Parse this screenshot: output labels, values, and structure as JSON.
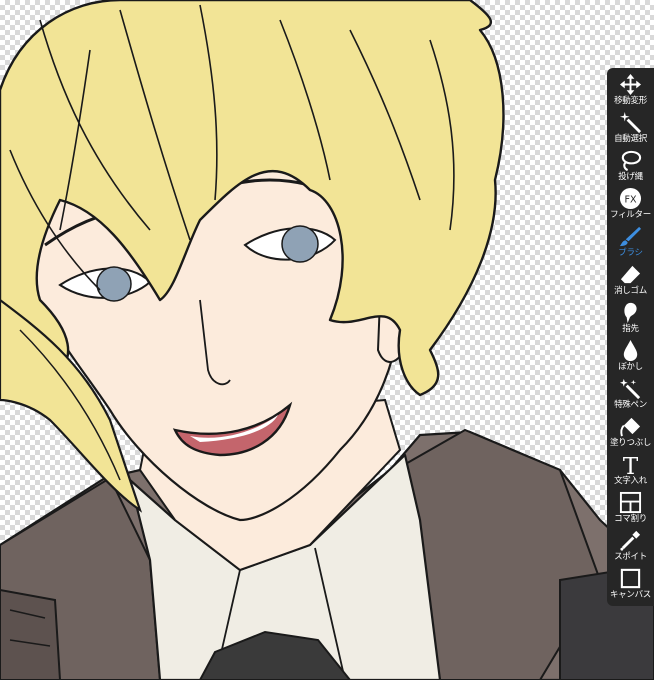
{
  "app": {
    "name": "Drawing canvas with tool palette"
  },
  "colors": {
    "hair": "#f2e496",
    "skin": "#fcebdc",
    "jacket": "#7d706c",
    "shirt": "#f0ede4",
    "tie": "#3a3a3a",
    "eye": "#8fa2b5",
    "mouth": "#c4656c",
    "line": "#1a1a1a",
    "toolbar_bg": "#262626",
    "tool_label": "#ffffff",
    "active_tool": "#3d8ee0"
  },
  "toolbar": {
    "tools": [
      {
        "label": "移動変形",
        "icon": "move-icon",
        "active": false
      },
      {
        "label": "自動選択",
        "icon": "magic-wand-icon",
        "active": false
      },
      {
        "label": "投げ縄",
        "icon": "lasso-icon",
        "active": false
      },
      {
        "label": "フィルター",
        "icon": "fx-icon",
        "fx": "FX",
        "active": false
      },
      {
        "label": "ブラシ",
        "icon": "brush-icon",
        "active": true
      },
      {
        "label": "消しゴム",
        "icon": "eraser-icon",
        "active": false
      },
      {
        "label": "指先",
        "icon": "smudge-icon",
        "active": false
      },
      {
        "label": "ぼかし",
        "icon": "blur-drop-icon",
        "active": false
      },
      {
        "label": "特殊ペン",
        "icon": "special-pen-icon",
        "active": false
      },
      {
        "label": "塗りつぶし",
        "icon": "fill-bucket-icon",
        "active": false
      },
      {
        "label": "文字入れ",
        "icon": "text-icon",
        "glyph": "T",
        "active": false
      },
      {
        "label": "コマ割り",
        "icon": "frame-divider-icon",
        "active": false
      },
      {
        "label": "スポイト",
        "icon": "eyedropper-icon",
        "active": false
      },
      {
        "label": "キャンバス",
        "icon": "canvas-icon",
        "active": false
      }
    ]
  }
}
